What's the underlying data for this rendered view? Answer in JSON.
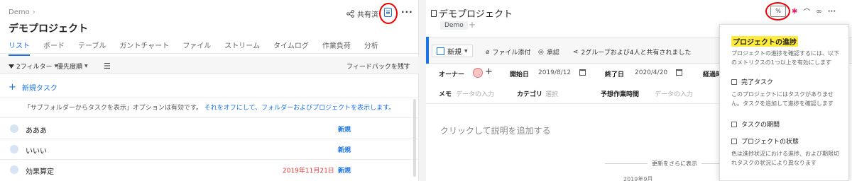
{
  "left": {
    "breadcrumb": "Demo",
    "title": "デモプロジェクト",
    "share_label": "共有済",
    "tabs": [
      "リスト",
      "ボード",
      "テーブル",
      "ガントチャート",
      "ファイル",
      "ストリーム",
      "タイムログ",
      "作業負荷",
      "分析"
    ],
    "filter_label": "2フィルター",
    "sort_label": "優先度順",
    "feedback_label": "フィードバックを残す",
    "new_task_label": "新規タスク",
    "notice_text": "「サブフォルダーからタスクを表示」オプションは有効です。",
    "notice_link": "それをオフにして、フォルダーおよびプロジェクトを表示します。",
    "rows": [
      {
        "name": "あああ",
        "status": "新規",
        "date": ""
      },
      {
        "name": "いいい",
        "status": "新規",
        "date": ""
      },
      {
        "name": "効果算定",
        "status": "新規",
        "date": "2019年11月21日"
      }
    ]
  },
  "right": {
    "title": "デモプロジェクト",
    "folder_chip": "Demo",
    "percent_label": "%",
    "new_button": "新規",
    "attach_label": "ファイル添付",
    "approve_label": "承認",
    "shared_label": "2グループおよび4人と共有されました",
    "owner_label": "オーナー",
    "start_label": "開始日",
    "start_value": "2019/8/12",
    "end_label": "終了日",
    "end_value": "2020/4/20",
    "elapsed_label": "経過時",
    "memo_label": "メモ",
    "memo_placeholder": "データの入力",
    "category_label": "カテゴリ",
    "category_placeholder": "選択",
    "estimate_label": "予想作業時間",
    "estimate_placeholder": "データの入力",
    "description_placeholder": "クリックして説明を追加する",
    "more_updates": "更新をさらに表示",
    "year_truncated": "2019年9月"
  },
  "popup": {
    "title": "プロジェクトの進捗",
    "desc": "プロジェクトの進捗を確認するには、以下のメトリクスの1つ以上を有効にします",
    "opt1": "完了タスク",
    "opt1_desc": "このプロジェクトにはタスクがありません。タスクを追加して進捗を確認します",
    "opt2": "タスクの期間",
    "opt3": "プロジェクトの状態",
    "opt3_desc": "色は進捗状況における進捗、および期限切れタスクの状況により異なります"
  },
  "colors": {
    "accent": "#1a73e8",
    "annotation": "#ee0000",
    "highlight": "#ffeb3b",
    "due_date": "#e53935"
  }
}
